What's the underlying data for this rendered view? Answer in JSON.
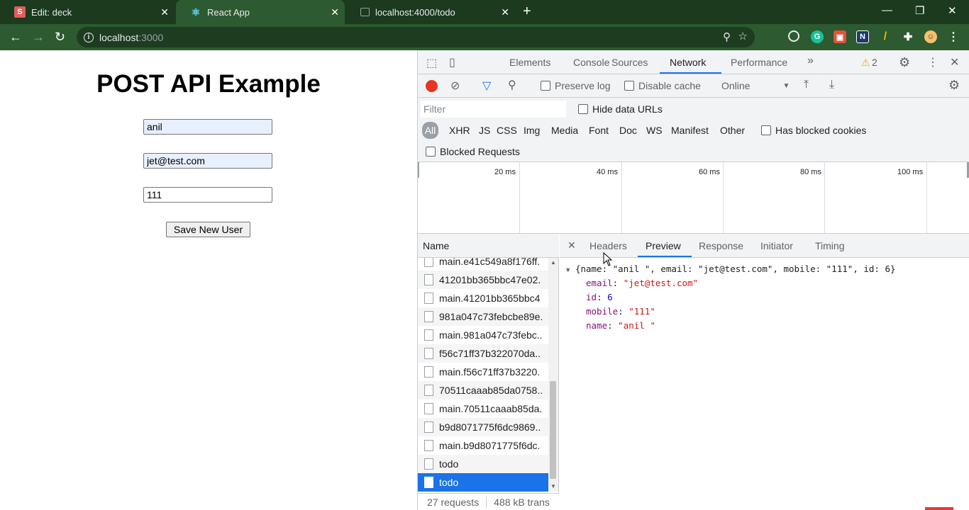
{
  "browser": {
    "tabs": [
      {
        "title": "Edit: deck",
        "icon": "S"
      },
      {
        "title": "React App",
        "icon": "react-icon"
      },
      {
        "title": "localhost:4000/todo",
        "icon": "page-icon"
      }
    ],
    "url_host": "localhost",
    "url_port": ":3000"
  },
  "app": {
    "title": "POST API Example",
    "name_value": "anil",
    "email_value": "jet@test.com",
    "mobile_value": "111",
    "save_label": "Save New User"
  },
  "devtools": {
    "tabs": [
      "Elements",
      "Console",
      "Sources",
      "Network",
      "Performance"
    ],
    "more": "»",
    "warning_count": "2",
    "toolbar": {
      "preserve_log": "Preserve log",
      "disable_cache": "Disable cache",
      "throttle": "Online"
    },
    "filter_placeholder": "Filter",
    "hide_data_urls": "Hide data URLs",
    "types": [
      "All",
      "XHR",
      "JS",
      "CSS",
      "Img",
      "Media",
      "Font",
      "Doc",
      "WS",
      "Manifest",
      "Other"
    ],
    "blocked_cookies": "Has blocked cookies",
    "blocked_requests": "Blocked Requests",
    "timeline_labels": [
      "20 ms",
      "40 ms",
      "60 ms",
      "80 ms",
      "100 ms"
    ],
    "name_header": "Name",
    "requests": [
      "main.e41c549a8f176ff.",
      "41201bb365bbc47e02.",
      "main.41201bb365bbc4",
      "981a047c73febcbe89e.",
      "main.981a047c73febc..",
      "f56c71ff37b322070da..",
      "main.f56c71ff37b3220.",
      "70511caaab85da0758..",
      "main.70511caaab85da.",
      "b9d8071775f6dc9869..",
      "main.b9d8071775f6dc.",
      "todo",
      "todo"
    ],
    "status_requests": "27 requests",
    "status_transfer": "488 kB trans",
    "detail_tabs": [
      "Headers",
      "Preview",
      "Response",
      "Initiator",
      "Timing"
    ],
    "preview": {
      "summary": "{name: \"anil \", email: \"jet@test.com\", mobile: \"111\", id: 6}",
      "email_key": "email",
      "email_val": "\"jet@test.com\"",
      "id_key": "id",
      "id_val": "6",
      "mobile_key": "mobile",
      "mobile_val": "\"111\"",
      "name_key": "name",
      "name_val": "\"anil \""
    }
  }
}
